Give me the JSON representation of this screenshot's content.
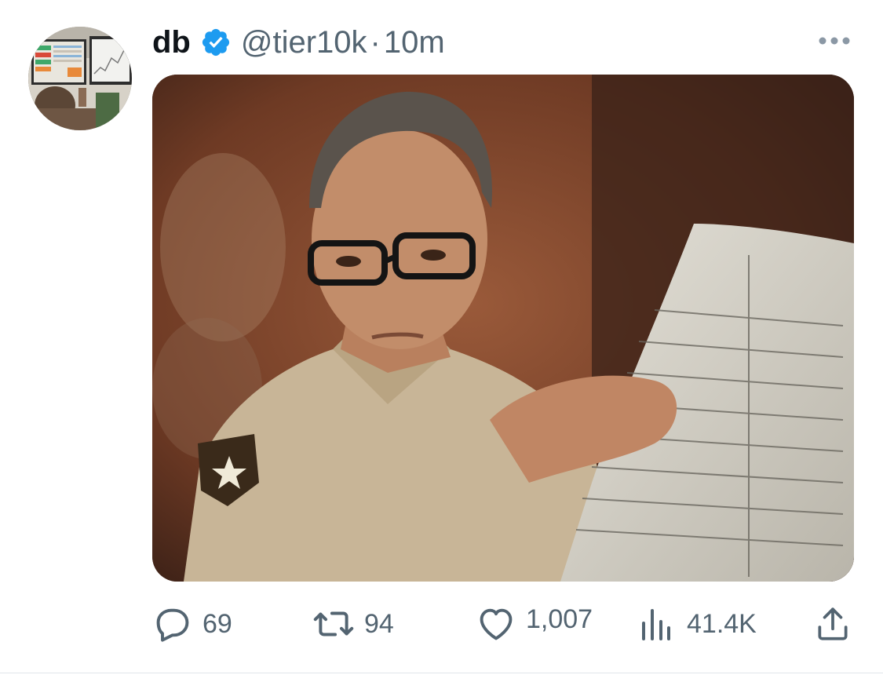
{
  "tweet": {
    "author_name": "db",
    "author_handle": "@tier10k",
    "separator": "·",
    "time": "10m",
    "verified": true,
    "media_description": "photo",
    "actions": {
      "replies": "69",
      "reposts": "94",
      "likes": "1,007",
      "views": "41.4K"
    }
  },
  "colors": {
    "verified": "#1d9bf0",
    "secondary_text": "#536471",
    "primary_text": "#0f1419"
  },
  "icons": {
    "reply": "reply-icon",
    "repost": "repost-icon",
    "like": "heart-icon",
    "views": "views-icon",
    "share": "share-icon",
    "more": "more-icon",
    "verified": "verified-badge-icon"
  }
}
